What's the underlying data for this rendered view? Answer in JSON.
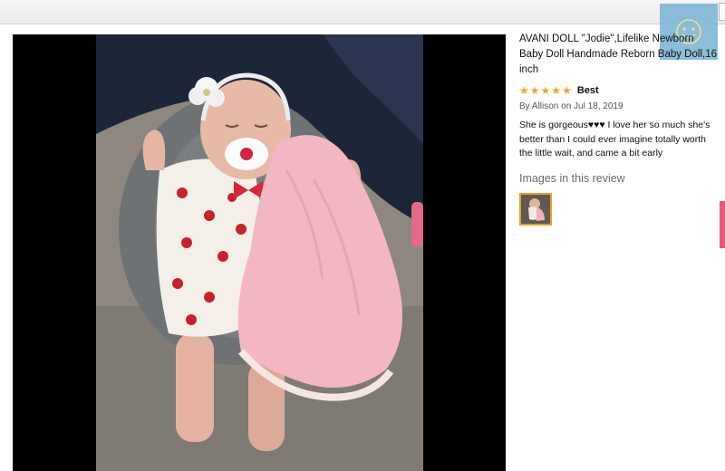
{
  "review": {
    "product_title": "AVANI DOLL \"Jodie\",Lifelike Newborn Baby Doll Handmade Reborn Baby Doll,16 inch",
    "stars": [
      "★",
      "★",
      "★",
      "★",
      "★"
    ],
    "headline": "Best",
    "byline": "By Allison on Jul 18, 2019",
    "body": "She is gorgeous♥♥♥ I love her so much she's better than I could ever imagine totally worth the little wait, and came a bit early",
    "images_heading": "Images in this review"
  },
  "colors": {
    "star": "#f3a621",
    "thumb_border": "#e8a317",
    "viewer_bg": "#000000"
  },
  "icons": {
    "rating": "star-icon",
    "avatar": "smiley-icon"
  }
}
